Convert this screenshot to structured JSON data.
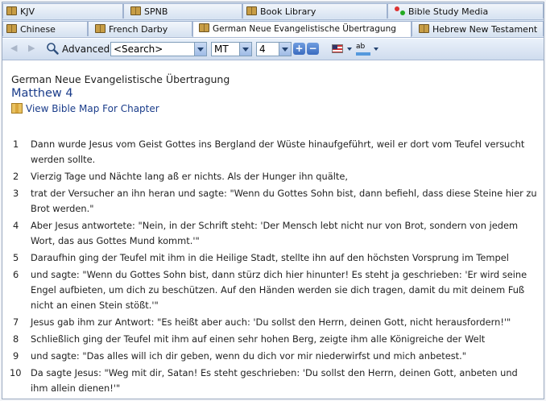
{
  "tabs_row1": [
    {
      "label": "KJV",
      "icon": "book-icon",
      "active": false
    },
    {
      "label": "SPNB",
      "icon": "book-icon",
      "active": false
    },
    {
      "label": "Book Library",
      "icon": "book-icon",
      "active": false
    },
    {
      "label": "Bible Study Media",
      "icon": "media-icon",
      "active": false
    }
  ],
  "tabs_row2": [
    {
      "label": "Chinese",
      "icon": "book-icon",
      "active": false
    },
    {
      "label": "French Darby",
      "icon": "book-icon",
      "active": false
    },
    {
      "label": "German Neue Evangelistische Übertragung",
      "icon": "book-icon",
      "active": true
    },
    {
      "label": "Hebrew New Testament",
      "icon": "book-icon",
      "active": false
    }
  ],
  "toolbar": {
    "back_icon": "back-arrow-icon",
    "forward_icon": "forward-arrow-icon",
    "advanced_label": "Advanced",
    "search_value": "<Search>",
    "book_value": "MT",
    "chapter_value": "4",
    "next_icon": "plus-icon",
    "prev_icon": "minus-icon"
  },
  "content": {
    "version_title": "German Neue Evangelistische Übertragung",
    "chapter_title": "Matthew 4",
    "map_link": "View Bible Map For Chapter",
    "verses": [
      {
        "num": "1",
        "text": "Dann wurde Jesus vom Geist Gottes ins Bergland der Wüste hinaufgeführt, weil er dort vom Teufel versucht werden sollte."
      },
      {
        "num": "2",
        "text": "Vierzig Tage und Nächte lang aß er nichts. Als der Hunger ihn quälte,"
      },
      {
        "num": "3",
        "text": "trat der Versucher an ihn heran und sagte: \"Wenn du Gottes Sohn bist, dann befiehl, dass diese Steine hier zu Brot werden.\""
      },
      {
        "num": "4",
        "text": "Aber Jesus antwortete: \"Nein, in der Schrift steht: 'Der Mensch lebt nicht nur von Brot, sondern von jedem Wort, das aus Gottes Mund kommt.'\""
      },
      {
        "num": "5",
        "text": "Daraufhin ging der Teufel mit ihm in die Heilige Stadt, stellte ihn auf den höchsten Vorsprung im Tempel"
      },
      {
        "num": "6",
        "text": "und sagte: \"Wenn du Gottes Sohn bist, dann stürz dich hier hinunter! Es steht ja geschrieben: 'Er wird seine Engel aufbieten, um dich zu beschützen. Auf den Händen werden sie dich tragen, damit du mit deinem Fuß nicht an einen Stein stößt.'\""
      },
      {
        "num": "7",
        "text": "Jesus gab ihm zur Antwort: \"Es heißt aber auch: 'Du sollst den Herrn, deinen Gott, nicht herausfordern!'\""
      },
      {
        "num": "8",
        "text": "Schließlich ging der Teufel mit ihm auf einen sehr hohen Berg, zeigte ihm alle Königreiche der Welt"
      },
      {
        "num": "9",
        "text": "und sagte: \"Das alles will ich dir geben, wenn du dich vor mir niederwirfst und mich anbetest.\""
      },
      {
        "num": "10",
        "text": "Da sagte Jesus: \"Weg mit dir, Satan! Es steht geschrieben: 'Du sollst den Herrn, deinen Gott, anbeten und ihm allein dienen!'\""
      }
    ]
  }
}
